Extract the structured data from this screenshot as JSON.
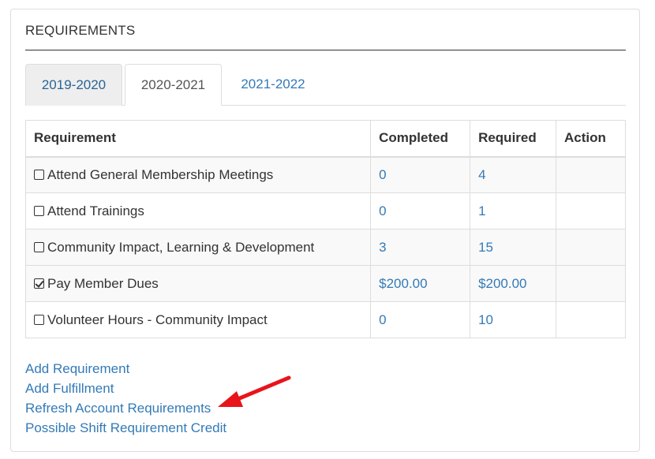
{
  "panel": {
    "title": "REQUIREMENTS"
  },
  "tabs": [
    {
      "label": "2019-2020"
    },
    {
      "label": "2020-2021"
    },
    {
      "label": "2021-2022"
    }
  ],
  "table": {
    "headers": [
      "Requirement",
      "Completed",
      "Required",
      "Action"
    ],
    "rows": [
      {
        "name": "Attend General Membership Meetings",
        "checked": false,
        "completed": "0",
        "required": "4"
      },
      {
        "name": "Attend Trainings",
        "checked": false,
        "completed": "0",
        "required": "1"
      },
      {
        "name": "Community Impact, Learning & Development",
        "checked": false,
        "completed": "3",
        "required": "15"
      },
      {
        "name": "Pay Member Dues",
        "checked": true,
        "completed": "$200.00",
        "required": "$200.00"
      },
      {
        "name": "Volunteer Hours - Community Impact",
        "checked": false,
        "completed": "0",
        "required": "10"
      }
    ]
  },
  "links": [
    "Add Requirement",
    "Add Fulfillment",
    "Refresh Account Requirements",
    "Possible Shift Requirement Credit"
  ],
  "colors": {
    "link": "#337ab7",
    "annotation_arrow": "#e8141b"
  }
}
